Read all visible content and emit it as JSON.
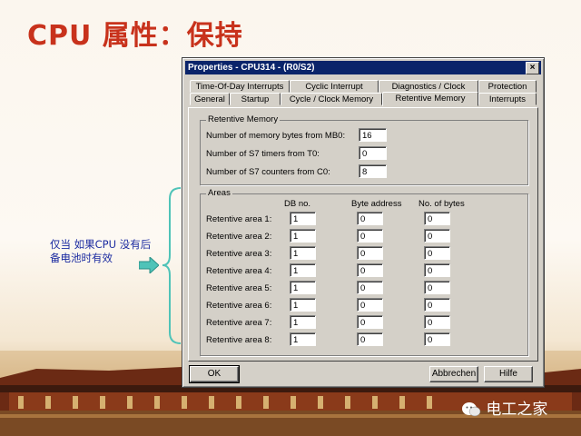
{
  "slide": {
    "title": "CPU 属性：保持",
    "annotation": "仅当 如果CPU 没有后备电池时有效"
  },
  "dialog": {
    "title": "Properties - CPU314 - (R0/S2)",
    "close_label": "×",
    "tabs_back": [
      "Time-Of-Day Interrupts",
      "Cyclic Interrupt",
      "Diagnostics / Clock",
      "Protection"
    ],
    "tabs_front": [
      "General",
      "Startup",
      "Cycle / Clock Memory",
      "Retentive Memory",
      "Interrupts"
    ],
    "active_tab": "Retentive Memory",
    "retentive": {
      "group_title": "Retentive Memory",
      "rows": [
        {
          "label": "Number of memory bytes from MB0:",
          "value": "16"
        },
        {
          "label": "Number of S7 timers from T0:",
          "value": "0"
        },
        {
          "label": "Number of S7 counters from C0:",
          "value": "8"
        }
      ]
    },
    "areas": {
      "group_title": "Areas",
      "headers": [
        "DB no.",
        "Byte address",
        "No. of bytes"
      ],
      "rows": [
        {
          "label": "Retentive area 1:",
          "db": "1",
          "byte": "0",
          "count": "0"
        },
        {
          "label": "Retentive area 2:",
          "db": "1",
          "byte": "0",
          "count": "0"
        },
        {
          "label": "Retentive area 3:",
          "db": "1",
          "byte": "0",
          "count": "0"
        },
        {
          "label": "Retentive area 4:",
          "db": "1",
          "byte": "0",
          "count": "0"
        },
        {
          "label": "Retentive area 5:",
          "db": "1",
          "byte": "0",
          "count": "0"
        },
        {
          "label": "Retentive area 6:",
          "db": "1",
          "byte": "0",
          "count": "0"
        },
        {
          "label": "Retentive area 7:",
          "db": "1",
          "byte": "0",
          "count": "0"
        },
        {
          "label": "Retentive area 8:",
          "db": "1",
          "byte": "0",
          "count": "0"
        }
      ]
    },
    "buttons": {
      "ok": "OK",
      "cancel": "Abbrechen",
      "help": "Hilfe"
    }
  },
  "watermark": {
    "text": "电工之家",
    "icon": "wechat-icon"
  },
  "colors": {
    "title_red": "#c8321c",
    "annotation_blue": "#1a2aa0",
    "titlebar": "#0a246a",
    "arrow_green": "#4fc3b8"
  }
}
